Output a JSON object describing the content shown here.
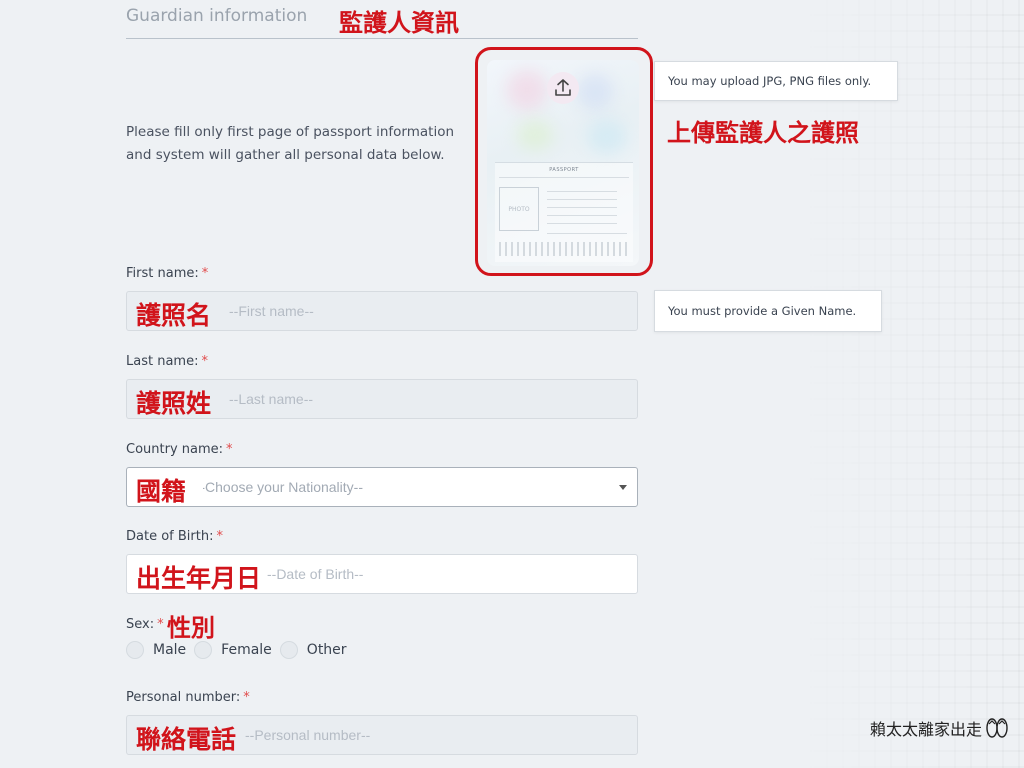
{
  "section": {
    "title": "Guardian information",
    "annotation": "監護人資訊"
  },
  "instructions": "Please fill only first page of passport information and system will gather all personal data below.",
  "upload": {
    "tooltip": "You may upload JPG, PNG files only.",
    "annotation": "上傳監護人之護照",
    "passport_title": "PASSPORT",
    "photo_label": "PHOTO"
  },
  "fields": {
    "first_name": {
      "label": "First name:",
      "placeholder": "--First name--",
      "annotation": "護照名",
      "tooltip": "You must provide a Given Name."
    },
    "last_name": {
      "label": "Last name:",
      "placeholder": "--Last name--",
      "annotation": "護照姓"
    },
    "country": {
      "label": "Country name:",
      "value": "--Choose your Nationality--",
      "annotation": "國籍"
    },
    "dob": {
      "label": "Date of Birth:",
      "placeholder": "--Date of Birth--",
      "annotation": "出生年月日"
    },
    "sex": {
      "label": "Sex:",
      "annotation": "性別",
      "options": [
        "Male",
        "Female",
        "Other"
      ]
    },
    "personal_number": {
      "label": "Personal number:",
      "placeholder": "--Personal number--",
      "annotation": "聯絡電話"
    }
  },
  "required_mark": "*",
  "watermark": "賴太太離家出走",
  "colors": {
    "annotation_red": "#d1141b",
    "required_red": "#e14a4a"
  }
}
